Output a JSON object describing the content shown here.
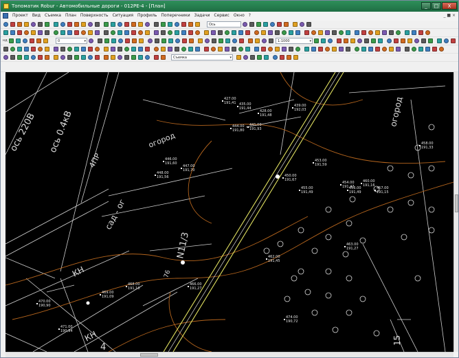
{
  "window": {
    "title": "Топоматик Robur - Автомобильные дороги - 012РЕ-4 - [План]",
    "buttons": {
      "minimize": "_",
      "maximize": "□",
      "close": "X"
    }
  },
  "menu": {
    "items": [
      "Проект",
      "Вид",
      "Съемка",
      "План",
      "Поверхность",
      "Ситуация",
      "Профиль",
      "Поперечники",
      "Задачи",
      "Сервис",
      "Окно",
      "?"
    ],
    "mdi_controls": "_ ■ ×"
  },
  "toolbar": {
    "row2_field": "Ось",
    "row3_field": "",
    "row4_field": "1:1000",
    "row4_small_field": "0",
    "layer_field": "Съемка",
    "row4_label": "нд"
  },
  "drawing": {
    "labels": {
      "road_left": "ось 220В",
      "road_mid": "ось 0.4кВ",
      "pr": "4ПР",
      "ogorod_top": "огород",
      "ogorod_right": "огород",
      "sad": "сад - ог",
      "n": "N11/3",
      "kh1": "КН",
      "kh2": "КН",
      "num4": "4",
      "num15": "15",
      "num76": "76"
    },
    "points": [
      {
        "n": "427.00",
        "v": "191,41"
      },
      {
        "n": "435.00",
        "v": "191,44"
      },
      {
        "n": "428.00",
        "v": "191,48"
      },
      {
        "n": "439.00",
        "v": "192,03"
      },
      {
        "n": "441.00",
        "v": "191,93"
      },
      {
        "n": "444.00",
        "v": "191,80"
      },
      {
        "n": "446.00",
        "v": "191,60"
      },
      {
        "n": "447.00",
        "v": "191,70"
      },
      {
        "n": "448.00",
        "v": "191,56"
      },
      {
        "n": "450.00",
        "v": "191,67"
      },
      {
        "n": "453.00",
        "v": "191,59"
      },
      {
        "n": "454.00",
        "v": "191,47"
      },
      {
        "n": "455.00",
        "v": "191,49"
      },
      {
        "n": "456.00",
        "v": "191,49"
      },
      {
        "n": "457.00",
        "v": "191,15"
      },
      {
        "n": "458.00",
        "v": "191,33"
      },
      {
        "n": "460.00",
        "v": "191,16"
      },
      {
        "n": "462.00",
        "v": "191,45"
      },
      {
        "n": "463.00",
        "v": "191,27"
      },
      {
        "n": "466.00",
        "v": "191,27"
      },
      {
        "n": "468.00",
        "v": "191,10"
      },
      {
        "n": "469.00",
        "v": "191,09"
      },
      {
        "n": "470.00",
        "v": "190,90"
      },
      {
        "n": "471.00",
        "v": "190,94"
      },
      {
        "n": "474.00",
        "v": "190,72"
      }
    ]
  },
  "colors": {
    "titlebar": "#1f6e44",
    "canvas": "#000000",
    "lines": "#d0d0d0",
    "contour": "#b5651d",
    "road": "#e0e060"
  }
}
